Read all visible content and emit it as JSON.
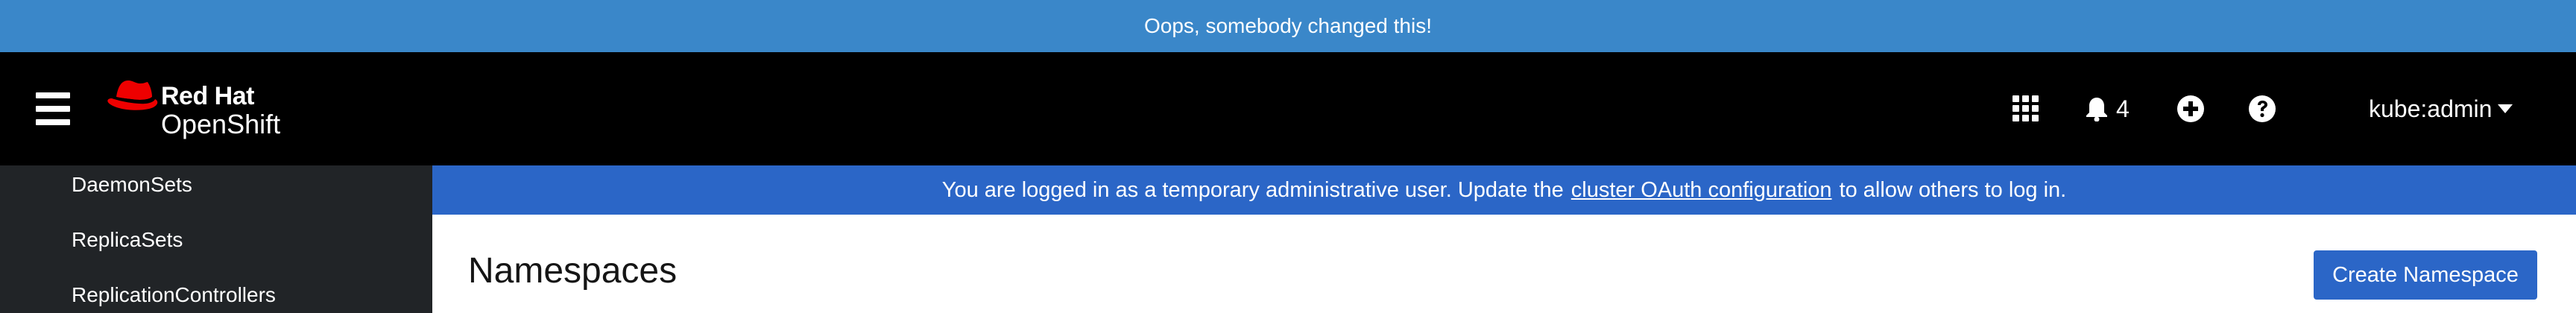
{
  "banner": {
    "text": "Oops, somebody changed this!"
  },
  "masthead": {
    "brand_line1": "Red Hat",
    "brand_line2": "OpenShift",
    "notification_count": "4",
    "user": "kube:admin",
    "icons": [
      "menu-icon",
      "apps-grid-icon",
      "bell-icon",
      "plus-circle-icon",
      "help-icon",
      "chevron-down-icon"
    ],
    "logo_color": "#ee0000"
  },
  "sidebar": {
    "items": [
      {
        "label": "DaemonSets"
      },
      {
        "label": "ReplicaSets"
      },
      {
        "label": "ReplicationControllers"
      }
    ]
  },
  "notice": {
    "prefix": "You are logged in as a temporary administrative user. Update the",
    "link": "cluster OAuth configuration",
    "suffix": "to allow others to log in."
  },
  "page": {
    "title": "Namespaces",
    "create_button": "Create Namespace"
  },
  "colors": {
    "banner_bg": "#3a87c9",
    "masthead_bg": "#000000",
    "sidebar_bg": "#212427",
    "notice_bg": "#2b66c7",
    "primary_button": "#2b66c7"
  }
}
